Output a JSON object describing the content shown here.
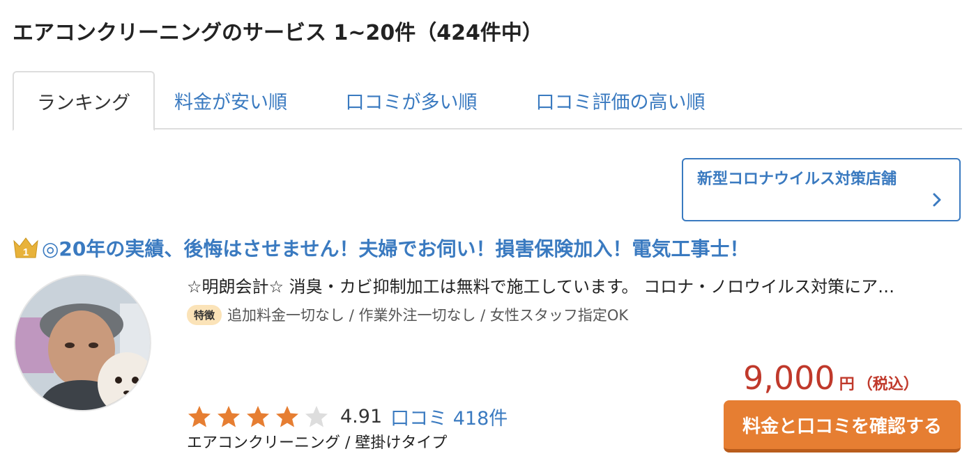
{
  "header": {
    "title": "エアコンクリーニングのサービス 1~20件（424件中）"
  },
  "tabs": [
    {
      "label": "ランキング",
      "active": true
    },
    {
      "label": "料金が安い順",
      "active": false
    },
    {
      "label": "口コミが多い順",
      "active": false
    },
    {
      "label": "口コミ評価の高い順",
      "active": false
    }
  ],
  "covid_filter": {
    "label": "新型コロナウイルス対策店舗"
  },
  "listing": {
    "rank": "1",
    "headline": "◎20年の実績、後悔はさせません！夫婦でお伺い！損害保険加入！電気工事士！",
    "description": "☆明朗会計☆ 消臭・カビ抑制加工は無料で施工しています。 コロナ・ノロウイルス対策にア…",
    "feature_badge": "特徴",
    "features_text": "追加料金一切なし / 作業外注一切なし / 女性スタッフ指定OK",
    "rating": {
      "score": "4.91",
      "value": 4.91,
      "max": 5,
      "review_link": "口コミ 418件"
    },
    "category": "エアコンクリーニング / 壁掛けタイプ",
    "price": {
      "value": "9,000",
      "unit": "円",
      "tax_note": "（税込）"
    },
    "cta_label": "料金と口コミを確認する"
  },
  "colors": {
    "accent_blue": "#3a7ac0",
    "price_red": "#c0392b",
    "cta_orange": "#e67e32",
    "star_orange": "#e67e32",
    "star_empty": "#dddddd",
    "badge_bg": "#fbe3b8"
  },
  "icons": {
    "crown": "crown-rank-icon",
    "chevron": "chevron-right-icon",
    "star": "star-icon"
  }
}
